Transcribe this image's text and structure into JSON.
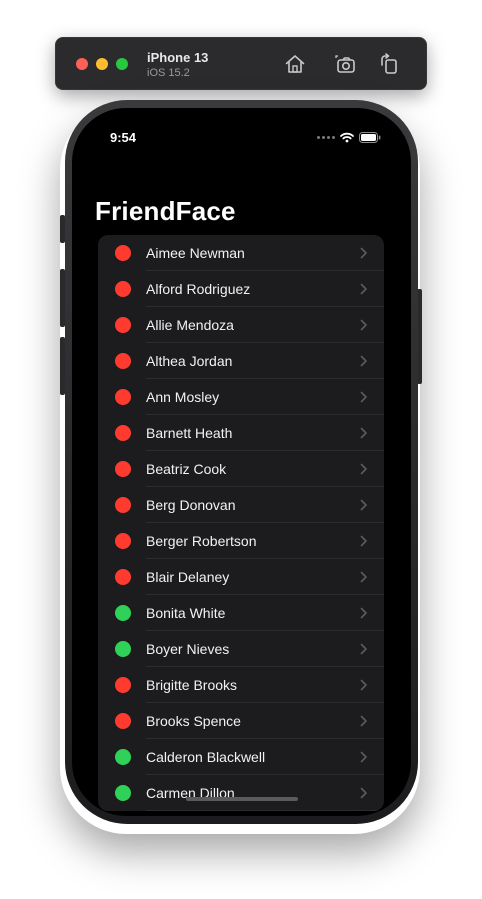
{
  "toolbar": {
    "device_name": "iPhone 13",
    "os_version": "iOS 15.2",
    "icons": [
      "home-icon",
      "screenshot-icon",
      "rotate-icon"
    ]
  },
  "status_bar": {
    "time": "9:54"
  },
  "nav": {
    "title": "FriendFace"
  },
  "colors": {
    "active": "#30d158",
    "inactive": "#ff3b30",
    "row_bg": "#1c1c1e",
    "screen_bg": "#000000"
  },
  "users": [
    {
      "name": "Aimee Newman",
      "status": "inactive"
    },
    {
      "name": "Alford Rodriguez",
      "status": "inactive"
    },
    {
      "name": "Allie Mendoza",
      "status": "inactive"
    },
    {
      "name": "Althea Jordan",
      "status": "inactive"
    },
    {
      "name": "Ann Mosley",
      "status": "inactive"
    },
    {
      "name": "Barnett Heath",
      "status": "inactive"
    },
    {
      "name": "Beatriz Cook",
      "status": "inactive"
    },
    {
      "name": "Berg Donovan",
      "status": "inactive"
    },
    {
      "name": "Berger Robertson",
      "status": "inactive"
    },
    {
      "name": "Blair Delaney",
      "status": "inactive"
    },
    {
      "name": "Bonita White",
      "status": "active"
    },
    {
      "name": "Boyer Nieves",
      "status": "active"
    },
    {
      "name": "Brigitte Brooks",
      "status": "inactive"
    },
    {
      "name": "Brooks Spence",
      "status": "inactive"
    },
    {
      "name": "Calderon Blackwell",
      "status": "active"
    },
    {
      "name": "Carmen Dillon",
      "status": "active"
    }
  ]
}
